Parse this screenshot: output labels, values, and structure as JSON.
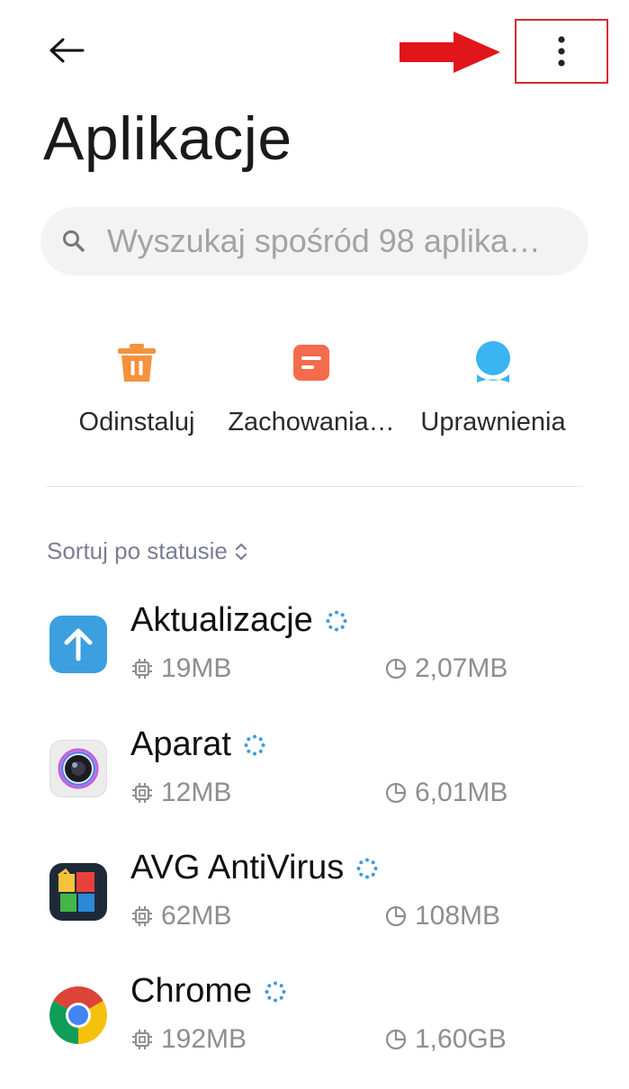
{
  "header": {
    "title": "Aplikacje",
    "back_icon": "arrow-left-icon",
    "more_icon": "more-vertical-icon"
  },
  "search": {
    "placeholder": "Wyszukaj spośród 98 aplika…"
  },
  "quick_actions": [
    {
      "label": "Odinstaluj",
      "icon": "trash-icon",
      "color": "#f5923e"
    },
    {
      "label": "Zachowania…",
      "icon": "document-icon",
      "color": "#f56b4d"
    },
    {
      "label": "Uprawnienia",
      "icon": "shield-person-icon",
      "color": "#3bb4f2"
    }
  ],
  "sort": {
    "label": "Sortuj po statusie"
  },
  "apps": [
    {
      "name": "Aktualizacje",
      "size": "19MB",
      "data": "2,07MB",
      "icon": "update-arrow-icon"
    },
    {
      "name": "Aparat",
      "size": "12MB",
      "data": "6,01MB",
      "icon": "camera-icon"
    },
    {
      "name": "AVG AntiVirus",
      "size": "62MB",
      "data": "108MB",
      "icon": "avg-antivirus-icon"
    },
    {
      "name": "Chrome",
      "size": "192MB",
      "data": "1,60GB",
      "icon": "chrome-icon"
    }
  ],
  "colors": {
    "annotation": "#d62b2b",
    "accent": "#3a9be0"
  }
}
